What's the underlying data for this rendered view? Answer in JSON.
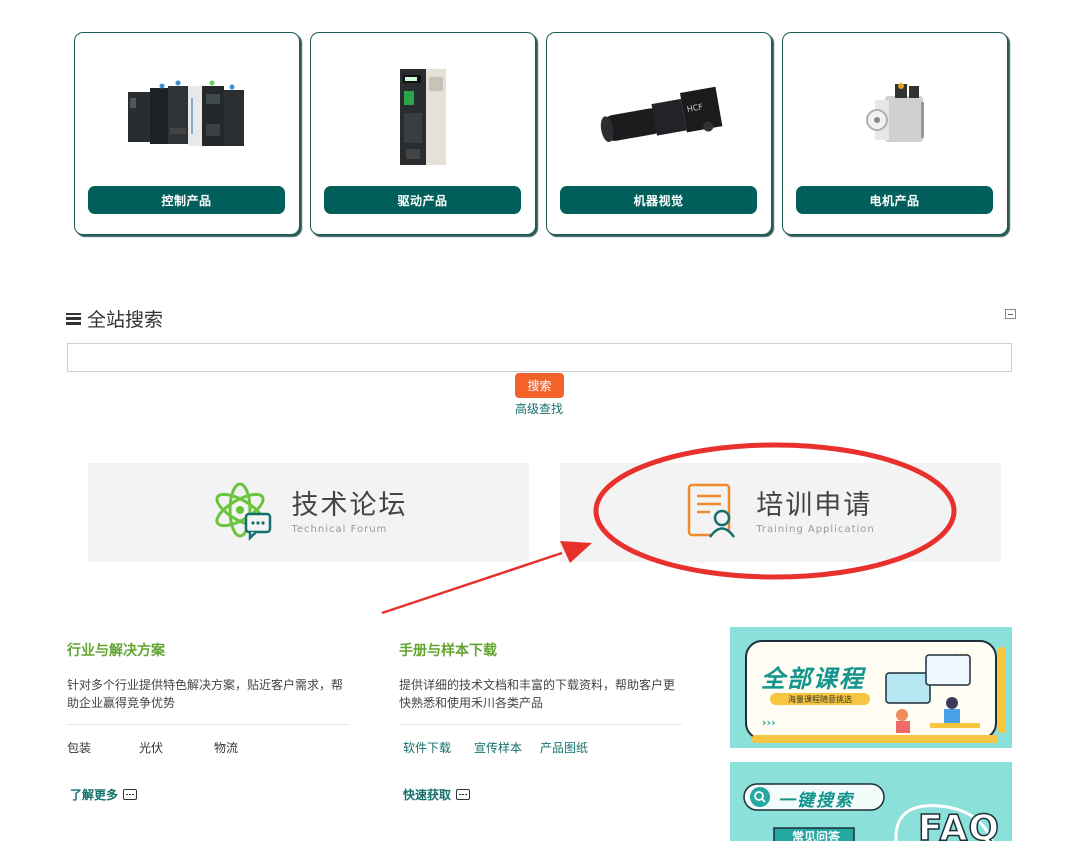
{
  "products": [
    {
      "label": "控制产品",
      "icon": "plc-icon"
    },
    {
      "label": "驱动产品",
      "icon": "servo-drive-icon"
    },
    {
      "label": "机器视觉",
      "icon": "camera-icon"
    },
    {
      "label": "电机产品",
      "icon": "motor-icon"
    }
  ],
  "search": {
    "title": "全站搜索",
    "input_value": "",
    "button": "搜索",
    "advanced": "高级查找"
  },
  "banners": [
    {
      "cn": "技术论坛",
      "en": "Technical Forum",
      "icon": "atom-chat-icon"
    },
    {
      "cn": "培训申请",
      "en": "Training Application",
      "icon": "document-user-icon"
    }
  ],
  "industry": {
    "title": "行业与解决方案",
    "desc": "针对多个行业提供特色解决方案，贴近客户需求，帮助企业赢得竞争优势",
    "links": [
      "包装",
      "光伏",
      "物流"
    ],
    "more": "了解更多"
  },
  "manuals": {
    "title": "手册与样本下载",
    "desc": "提供详细的技术文档和丰富的下载资料，帮助客户更快熟悉和使用禾川各类产品",
    "links": [
      "软件下载",
      "宣传样本",
      "产品图纸"
    ],
    "more": "快速获取"
  },
  "promos": {
    "courses_title": "全部课程",
    "courses_sub": "海量课程随意挑选",
    "search_title": "一键搜索",
    "faq_sub": "常见问答",
    "faq": "FAQ"
  },
  "colors": {
    "brand": "#005f5b",
    "accent": "#f2622a",
    "green_title": "#62a430",
    "highlight": "#e8312d"
  }
}
